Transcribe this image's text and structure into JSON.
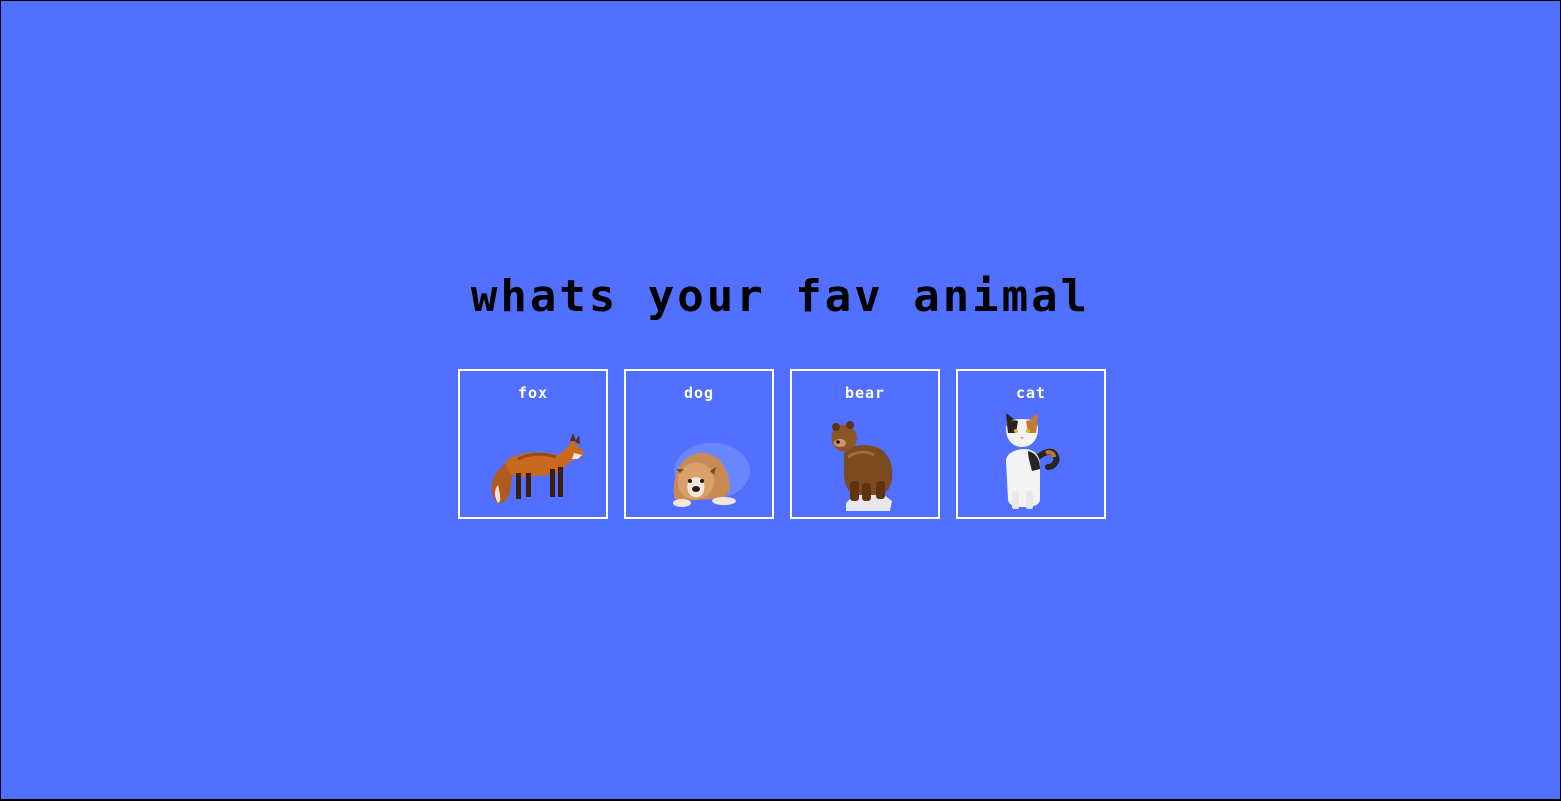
{
  "page": {
    "title": "whats your fav animal",
    "background_color": "#5170ff"
  },
  "animals": [
    {
      "label": "fox",
      "icon": "fox-icon"
    },
    {
      "label": "dog",
      "icon": "dog-icon"
    },
    {
      "label": "bear",
      "icon": "bear-icon"
    },
    {
      "label": "cat",
      "icon": "cat-icon"
    }
  ]
}
